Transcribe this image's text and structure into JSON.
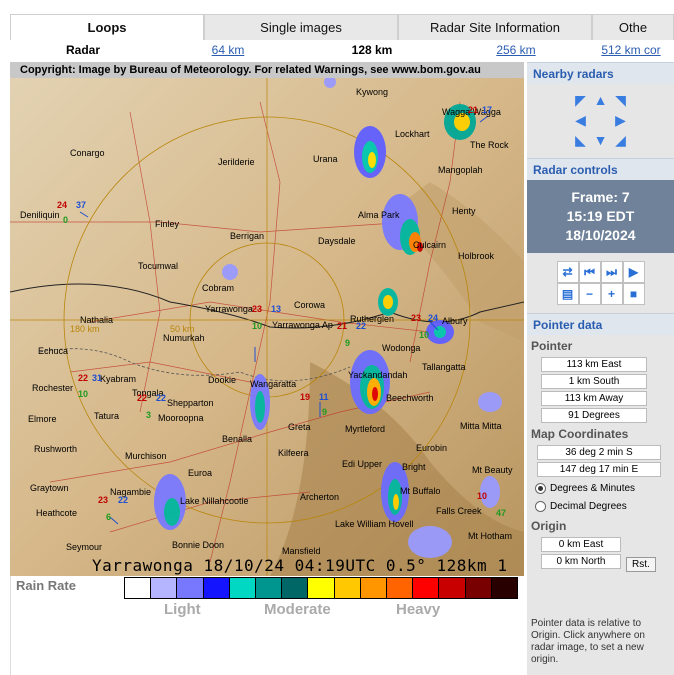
{
  "tabs": [
    "Loops",
    "Single images",
    "Radar Site Information",
    "Othe"
  ],
  "subtabs": [
    "Radar",
    "64 km",
    "128 km",
    "256 km",
    "512 km cor"
  ],
  "radar": {
    "copyright": "Copyright: Image by Bureau of Meteorology. For related Warnings, see www.bom.gov.au",
    "caption": "Yarrawonga 18/10/24 04:19UTC 0.5° 128km 1",
    "range_labels": [
      "180 km",
      "50 km"
    ],
    "places": [
      "Kywong",
      "Wagga Wagga",
      "Lockhart",
      "The Rock",
      "Conargo",
      "Jerilderie",
      "Urana",
      "Mangoplah",
      "Deniliquin",
      "Finley",
      "Henty",
      "Alma Park",
      "Berrigan",
      "Daysdale",
      "Culcairn",
      "Tocumwal",
      "Holbrook",
      "Cobram",
      "Yarrawonga",
      "Corowa",
      "Nathalia",
      "Numurkah",
      "Rutherglen",
      "Echuca",
      "Yarrawonga Ap",
      "Wodonga",
      "Albury",
      "Tallangatta",
      "Rochester",
      "Kyabram",
      "Dookie",
      "Wangaratta",
      "Yackandandah",
      "Beechworth",
      "Shepparton",
      "Tatura",
      "Elmore",
      "Tongala",
      "Mooroopna",
      "Benalla",
      "Greta",
      "Myrtleford",
      "Mitta Mitta",
      "Rushworth",
      "Murchison",
      "Kilfeera",
      "Eurobin",
      "Edi Upper",
      "Bright",
      "Euroa",
      "Mt Beauty",
      "Graytown",
      "Lake Nillahcootie",
      "Archerton",
      "Mt Buffalo",
      "Heathcote",
      "Nagambie",
      "Falls Creek",
      "Bonnie Doon",
      "Lake William Hovell",
      "Mt Hotham",
      "Seymour",
      "Mansfield"
    ],
    "site_numbers": [
      "24",
      "37",
      "0",
      "21",
      "17",
      "23",
      "13",
      "10",
      "21",
      "22",
      "9",
      "23",
      "24",
      "10",
      "22",
      "31",
      "10",
      "22",
      "22",
      "19",
      "11",
      "3",
      "9",
      "23",
      "22",
      "6",
      "10",
      "47"
    ]
  },
  "rain_rate": {
    "label": "Rain Rate",
    "words": [
      "Light",
      "Moderate",
      "Heavy"
    ],
    "colors": [
      "#ffffff",
      "#b4b4ff",
      "#7878ff",
      "#1414ff",
      "#00d8c3",
      "#009690",
      "#006666",
      "#ffff00",
      "#ffc800",
      "#ff9600",
      "#ff6400",
      "#ff0000",
      "#c80000",
      "#780000",
      "#280000"
    ]
  },
  "sidebar": {
    "nearby_title": "Nearby radars",
    "controls_title": "Radar controls",
    "frame": {
      "label": "Frame: 7",
      "time": "15:19 EDT",
      "date": "18/10/2024"
    },
    "pointer_title": "Pointer data",
    "pointer_label": "Pointer",
    "pointer_values": [
      "113 km East",
      "1 km South",
      "113 km Away",
      "91 Degrees"
    ],
    "map_label": "Map Coordinates",
    "map_values": [
      "36 deg 2 min S",
      "147 deg 17 min E"
    ],
    "radio_options": [
      "Degrees & Minutes",
      "Decimal Degrees"
    ],
    "origin_label": "Origin",
    "origin_values": [
      "0 km East",
      "0 km North"
    ],
    "reset_label": "Rst.",
    "note": "Pointer data is relative to Origin. Click anywhere on radar image, to set a new origin."
  },
  "colors": {
    "link": "#2a5db0",
    "frame_bg": "#6f8299",
    "terrain": "#d9bf94"
  }
}
